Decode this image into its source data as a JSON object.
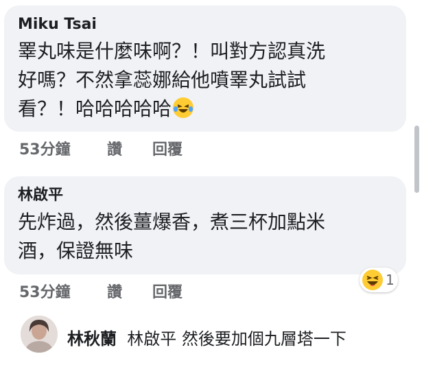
{
  "comments": [
    {
      "author": "Miku Tsai",
      "lines": [
        "睪丸味是什麼味啊？！叫對方認真洗",
        "好嗎？不然拿蕊娜給他噴睪丸試試",
        "看？！哈哈哈哈哈"
      ],
      "emoji_icon": "laughing-tears-emoji",
      "time": "53分鐘",
      "like_label": "讚",
      "reply_label": "回覆"
    },
    {
      "author": "林啟平",
      "lines": [
        "先炸過，然後薑爆香，煮三杯加點米",
        "酒，保證無味"
      ],
      "time": "53分鐘",
      "like_label": "讚",
      "reply_label": "回覆",
      "reaction": {
        "icon": "haha-emoji",
        "count": "1"
      }
    }
  ],
  "reply_preview": {
    "author": "林秋蘭",
    "text": "林啟平 然後要加個九層塔一下"
  },
  "colors": {
    "bubble": "#f0f2f5",
    "meta": "#65676b",
    "emoji": "#ffcc33"
  }
}
